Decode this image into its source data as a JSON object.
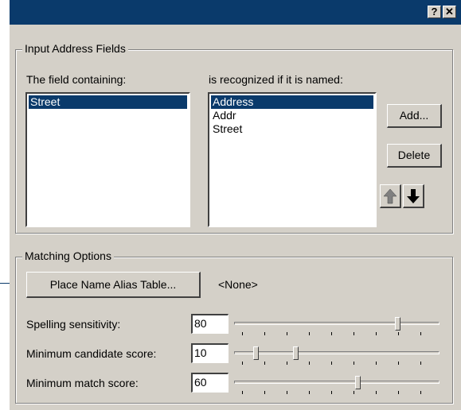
{
  "titlebar": {
    "help_label": "?",
    "close_label": "✕"
  },
  "input_fields": {
    "legend": "Input Address Fields",
    "field_label": "The field containing:",
    "recognized_label": "is recognized if it is named:",
    "fields": [
      "Street"
    ],
    "aliases": [
      "Address",
      "Addr",
      "Street"
    ],
    "add_label": "Add...",
    "delete_label": "Delete",
    "move_up_icon": "arrow-up-icon",
    "move_down_icon": "arrow-down-icon"
  },
  "matching": {
    "legend": "Matching Options",
    "alias_button_label": "Place Name Alias Table...",
    "alias_value": "<None>",
    "spelling": {
      "label": "Spelling sensitivity:",
      "value": "80"
    },
    "candidate": {
      "label": "Minimum candidate score:",
      "value": "10"
    },
    "match": {
      "label": "Minimum match score:",
      "value": "60"
    }
  },
  "colors": {
    "title_bar": "#0a3a6b",
    "selection": "#0a3a6b",
    "dialog": "#d4d0c8"
  }
}
